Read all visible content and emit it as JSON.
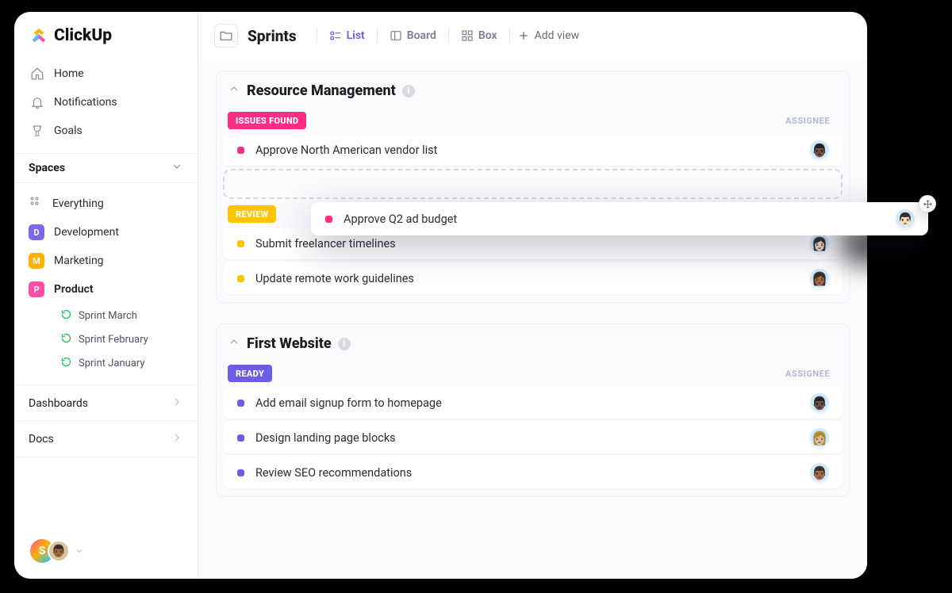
{
  "brand": "ClickUp",
  "nav": {
    "home": "Home",
    "notifications": "Notifications",
    "goals": "Goals"
  },
  "spaces": {
    "header": "Spaces",
    "everything": "Everything",
    "items": [
      {
        "letter": "D",
        "label": "Development"
      },
      {
        "letter": "M",
        "label": "Marketing"
      },
      {
        "letter": "P",
        "label": "Product"
      }
    ],
    "sprints": [
      {
        "label": "Sprint  March"
      },
      {
        "label": "Sprint  February"
      },
      {
        "label": "Sprint January"
      }
    ]
  },
  "bottom": {
    "dashboards": "Dashboards",
    "docs": "Docs"
  },
  "user": {
    "initial": "S"
  },
  "topbar": {
    "title": "Sprints",
    "views": {
      "list": "List",
      "board": "Board",
      "box": "Box"
    },
    "addview": "Add view"
  },
  "lists": [
    {
      "name": "Resource Management",
      "groups": [
        {
          "status": "ISSUES FOUND",
          "pill": "pill-issues",
          "dot": "d-pink",
          "assignee_label": "ASSIGNEE",
          "tasks": [
            {
              "name": "Approve North American vendor list",
              "face": "👨🏿"
            }
          ],
          "drop": true
        },
        {
          "status": "REVIEW",
          "pill": "pill-review",
          "dot": "d-yel",
          "tasks": [
            {
              "name": "Submit freelancer timelines",
              "face": "👩🏻"
            },
            {
              "name": "Update remote work guidelines",
              "face": "👩🏾"
            }
          ]
        }
      ]
    },
    {
      "name": "First Website",
      "groups": [
        {
          "status": "READY",
          "pill": "pill-ready",
          "dot": "d-pur",
          "assignee_label": "ASSIGNEE",
          "tasks": [
            {
              "name": "Add email signup form to homepage",
              "face": "👨🏿"
            },
            {
              "name": "Design landing page blocks",
              "face": "👩🏼"
            },
            {
              "name": "Review SEO recommendations",
              "face": "👨🏾"
            }
          ]
        }
      ]
    }
  ],
  "drag": {
    "name": "Approve Q2 ad budget",
    "face": "👨🏻"
  }
}
